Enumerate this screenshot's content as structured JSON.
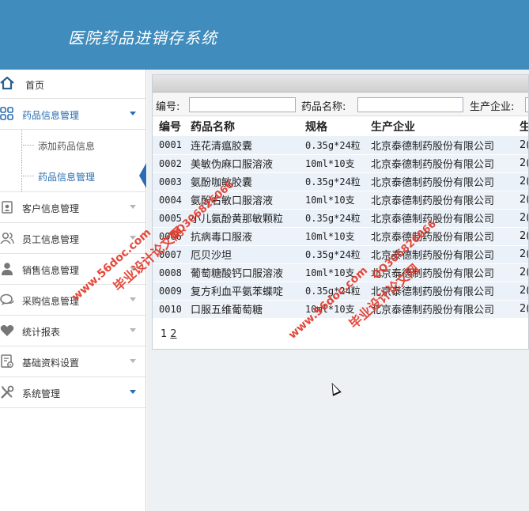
{
  "header": {
    "title": "医院药品进销存系统"
  },
  "sidebar": {
    "home": "首页",
    "groups": [
      {
        "label": "药品信息管理",
        "icon": "grid-icon",
        "expanded": true,
        "children": [
          {
            "label": "添加药品信息"
          },
          {
            "label": "药品信息管理",
            "current": true
          }
        ]
      },
      {
        "label": "客户信息管理",
        "icon": "contacts-icon"
      },
      {
        "label": "员工信息管理",
        "icon": "users-icon"
      },
      {
        "label": "销售信息管理",
        "icon": "user-icon"
      },
      {
        "label": "采购信息管理",
        "icon": "chat-icon"
      },
      {
        "label": "统计报表",
        "icon": "heart-icon"
      },
      {
        "label": "基础资料设置",
        "icon": "settings-doc-icon"
      },
      {
        "label": "系统管理",
        "icon": "tools-icon"
      }
    ]
  },
  "search": {
    "code_label": "编号:",
    "name_label": "药品名称:",
    "maker_label": "生产企业:",
    "code_value": "",
    "name_value": "",
    "maker_value": ""
  },
  "table": {
    "headers": [
      "编号",
      "药品名称",
      "规格",
      "生产企业",
      "生"
    ],
    "rows": [
      [
        "0001",
        "连花清瘟胶囊",
        "0.35g*24粒",
        "北京泰德制药股份有限公司",
        "2("
      ],
      [
        "0002",
        "美敏伪麻口服溶液",
        "10ml*10支",
        "北京泰德制药股份有限公司",
        "2("
      ],
      [
        "0003",
        "氨酚咖敏胶囊",
        "0.35g*24粒",
        "北京泰德制药股份有限公司",
        "2("
      ],
      [
        "0004",
        "氨酚右敏口服溶液",
        "10ml*10支",
        "北京泰德制药股份有限公司",
        "2("
      ],
      [
        "0005",
        "小儿氨酚黄那敏颗粒",
        "0.35g*24粒",
        "北京泰德制药股份有限公司",
        "2("
      ],
      [
        "0006",
        "抗病毒口服液",
        "10ml*10支",
        "北京泰德制药股份有限公司",
        "2("
      ],
      [
        "0007",
        "厄贝沙坦",
        "0.35g*24粒",
        "北京泰德制药股份有限公司",
        "2("
      ],
      [
        "0008",
        "葡萄糖酸钙口服溶液",
        "10ml*10支",
        "北京泰德制药股份有限公司",
        "2("
      ],
      [
        "0009",
        "复方利血平氨苯蝶啶",
        "0.35g*24粒",
        "北京泰德制药股份有限公司",
        "2("
      ],
      [
        "0010",
        "口服五维葡萄糖",
        "10ml*10支",
        "北京泰德制药股份有限公司",
        "2("
      ]
    ]
  },
  "pager": {
    "pages": [
      "1",
      "2"
    ]
  },
  "watermark": {
    "site": "www.56doc.com",
    "qq": "QQ306826066",
    "brand": "毕业设计论文网"
  }
}
